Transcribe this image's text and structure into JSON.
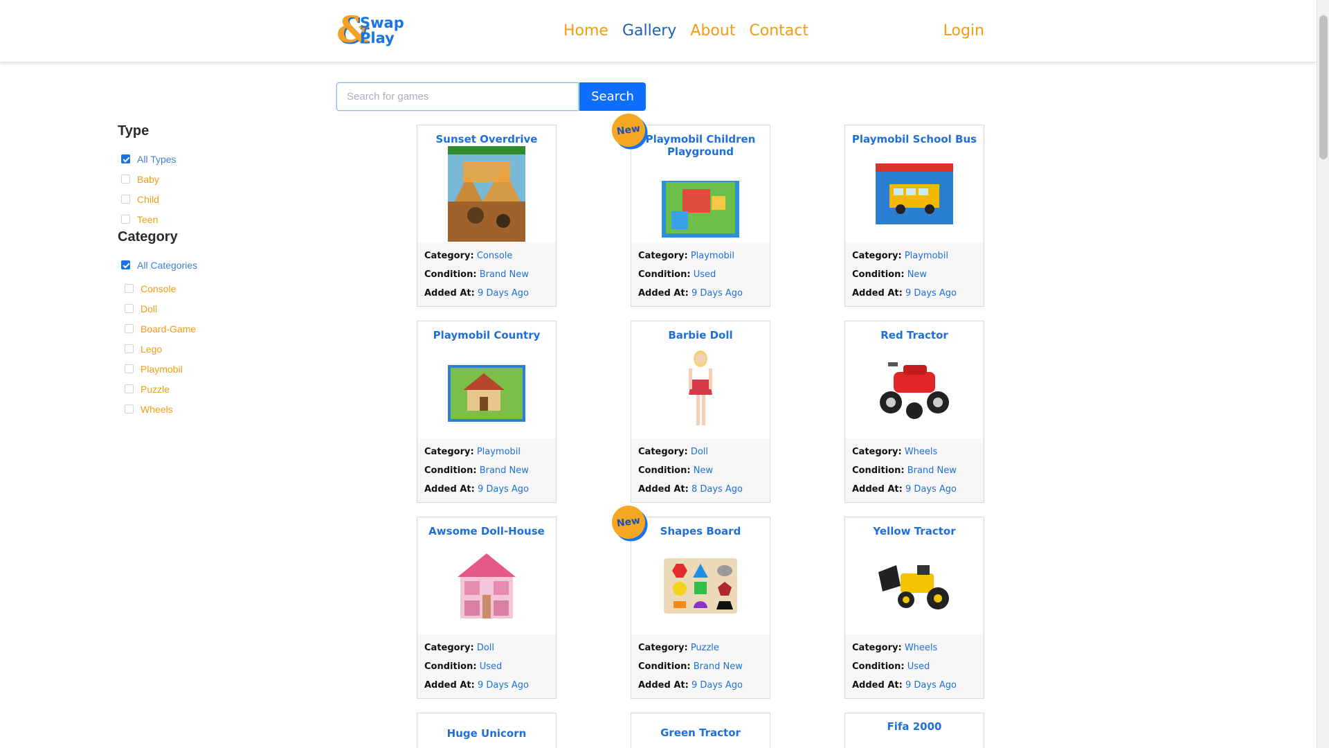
{
  "header": {
    "logo": {
      "line1": "Swap",
      "line2": "Play",
      "symbol": "&"
    },
    "nav": [
      {
        "label": "Home",
        "active": false
      },
      {
        "label": "Gallery",
        "active": true
      },
      {
        "label": "About",
        "active": false
      },
      {
        "label": "Contact",
        "active": false
      }
    ],
    "login_label": "Login"
  },
  "search": {
    "placeholder": "Search for games",
    "value": "",
    "button_label": "Search"
  },
  "filters": {
    "type": {
      "title": "Type",
      "all": {
        "label": "All Types",
        "checked": true
      },
      "items": [
        {
          "label": "Baby",
          "checked": false
        },
        {
          "label": "Child",
          "checked": false
        },
        {
          "label": "Teen",
          "checked": false
        }
      ]
    },
    "category": {
      "title": "Category",
      "all": {
        "label": "All Categories",
        "checked": true
      },
      "items": [
        {
          "label": "Console",
          "checked": false
        },
        {
          "label": "Doll",
          "checked": false
        },
        {
          "label": "Board-Game",
          "checked": false
        },
        {
          "label": "Lego",
          "checked": false
        },
        {
          "label": "Playmobil",
          "checked": false
        },
        {
          "label": "Puzzle",
          "checked": false
        },
        {
          "label": "Wheels",
          "checked": false
        }
      ]
    }
  },
  "labels": {
    "category": "Category:",
    "condition": "Condition:",
    "added": "Added At:",
    "badge": "New"
  },
  "products": [
    {
      "title": "Sunset Overdrive",
      "category": "Console",
      "condition": "Brand New",
      "added": "9 Days Ago",
      "badge": false,
      "image": "game-cover"
    },
    {
      "title": "Playmobil Children Playground",
      "category": "Playmobil",
      "condition": "Used",
      "added": "9 Days Ago",
      "badge": true,
      "image": "playground-box"
    },
    {
      "title": "Playmobil School Bus",
      "category": "Playmobil",
      "condition": "New",
      "added": "9 Days Ago",
      "badge": false,
      "image": "school-bus-box"
    },
    {
      "title": "Playmobil Country",
      "category": "Playmobil",
      "condition": "Brand New",
      "added": "9 Days Ago",
      "badge": false,
      "image": "country-box"
    },
    {
      "title": "Barbie Doll",
      "category": "Doll",
      "condition": "New",
      "added": "8 Days Ago",
      "badge": false,
      "image": "doll"
    },
    {
      "title": "Red Tractor",
      "category": "Wheels",
      "condition": "Brand New",
      "added": "9 Days Ago",
      "badge": false,
      "image": "red-quad"
    },
    {
      "title": "Awsome Doll-House",
      "category": "Doll",
      "condition": "Used",
      "added": "9 Days Ago",
      "badge": false,
      "image": "doll-house"
    },
    {
      "title": "Shapes Board",
      "category": "Puzzle",
      "condition": "Brand New",
      "added": "9 Days Ago",
      "badge": true,
      "image": "shapes-board"
    },
    {
      "title": "Yellow Tractor",
      "category": "Wheels",
      "condition": "Used",
      "added": "9 Days Ago",
      "badge": false,
      "image": "yellow-tractor"
    },
    {
      "title": "Huge Unicorn",
      "badge": false
    },
    {
      "title": "Green Tractor",
      "badge": false
    },
    {
      "title": "Fifa 2000",
      "badge": false
    }
  ],
  "colors": {
    "accent": "#f39c12",
    "link": "#1e6fd9",
    "button": "#0d6efd",
    "badge": "#f5a623"
  }
}
